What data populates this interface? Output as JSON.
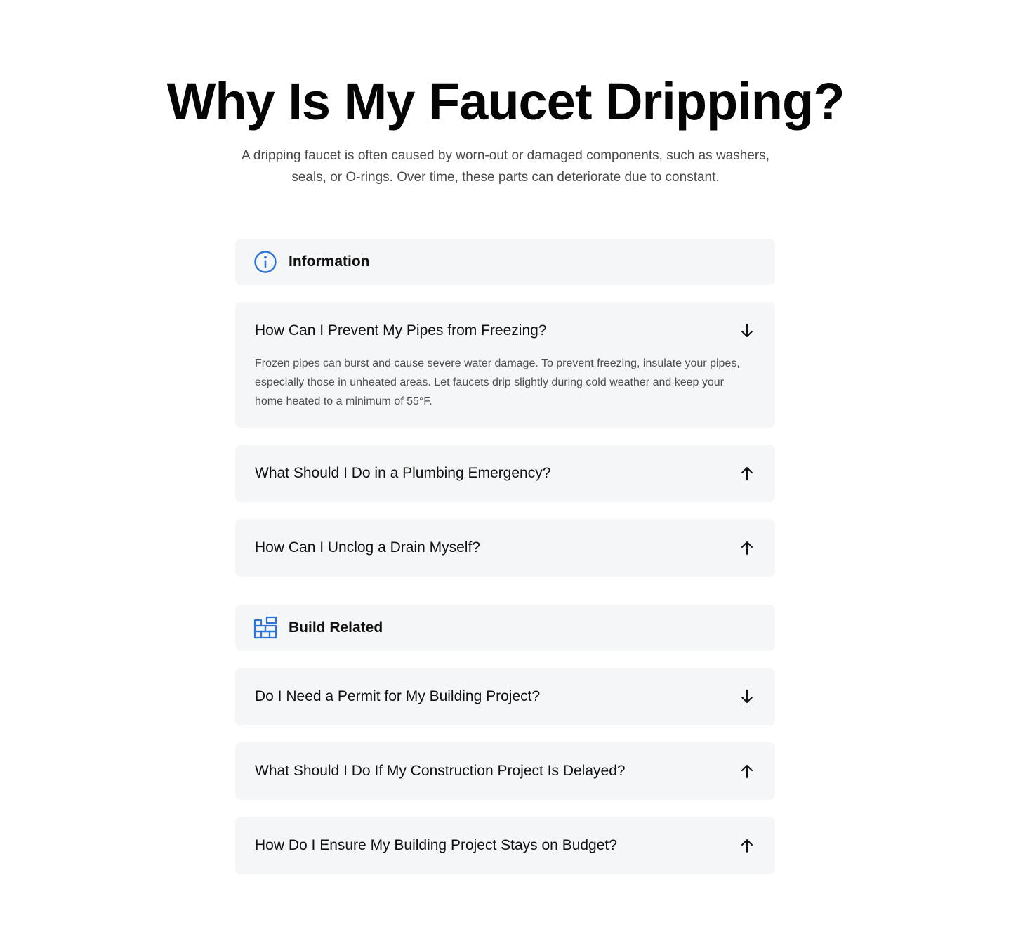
{
  "hero": {
    "title": "Why Is My Faucet Dripping?",
    "subtitle": "A dripping faucet is often caused by worn-out or damaged components, such as washers, seals, or O-rings. Over time, these parts can deteriorate due to constant."
  },
  "colors": {
    "accent": "#2e74d4",
    "card_bg": "#f5f6f8",
    "text": "#111111",
    "muted": "#4d4d4d"
  },
  "categories": [
    {
      "label": "Information",
      "icon": "info-icon",
      "items": [
        {
          "question": "How Can I Prevent My Pipes from Freezing?",
          "expanded": true,
          "arrow": "arrow-down-icon",
          "answer": "Frozen pipes can burst and cause severe water damage. To prevent freezing, insulate your pipes, especially those in unheated areas. Let faucets drip slightly during cold weather and keep your home heated to a minimum of 55°F."
        },
        {
          "question": "What Should I Do in a Plumbing Emergency?",
          "expanded": false,
          "arrow": "arrow-up-icon"
        },
        {
          "question": "How Can I Unclog a Drain Myself?",
          "expanded": false,
          "arrow": "arrow-up-icon"
        }
      ]
    },
    {
      "label": "Build Related",
      "icon": "brick-wall-icon",
      "items": [
        {
          "question": "Do I Need a Permit for My Building Project?",
          "expanded": false,
          "arrow": "arrow-down-icon"
        },
        {
          "question": "What Should I Do If My Construction Project Is Delayed?",
          "expanded": false,
          "arrow": "arrow-up-icon"
        },
        {
          "question": "How Do I Ensure My Building Project Stays on Budget?",
          "expanded": false,
          "arrow": "arrow-up-icon"
        }
      ]
    }
  ]
}
